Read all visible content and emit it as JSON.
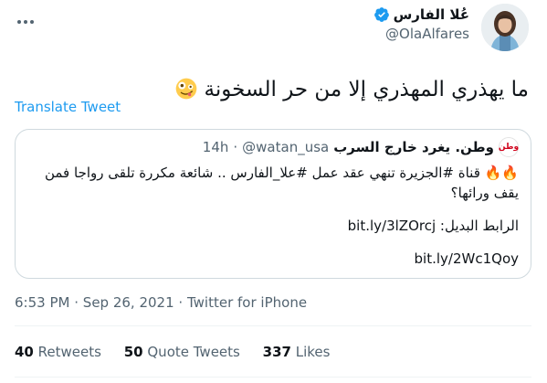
{
  "author": {
    "display_name": "عُلا الفارس",
    "handle": "@OlaAlfares",
    "verified": true,
    "avatar_icon": "woman-avatar-icon"
  },
  "tweet": {
    "text": "ما يهذري المهذري إلا من حر السخونة",
    "emoji": "zany-face-emoji",
    "translate_label": "Translate Tweet"
  },
  "quoted": {
    "name": "وطن. يغرد خارج السرب",
    "handle": "@watan_usa",
    "separator": "·",
    "time": "14h",
    "logo_text": "وطن",
    "line1": "🔥🔥 قناة #الجزيرة تنهي عقد عمل #علا_الفارس .. شائعة مكررة تلقى رواجا فمن يقف ورائها؟",
    "line2_label": "الرابط البديل:",
    "line2_link": "bit.ly/3lZOrcj",
    "line3_link": "bit.ly/2Wc1Qoy"
  },
  "meta": {
    "time": "6:53 PM",
    "separator1": "·",
    "date": "Sep 26, 2021",
    "separator2": "·",
    "source": "Twitter for iPhone"
  },
  "stats": {
    "retweets_count": "40",
    "retweets_label": "Retweets",
    "quotes_count": "50",
    "quotes_label": "Quote Tweets",
    "likes_count": "337",
    "likes_label": "Likes"
  },
  "colors": {
    "accent": "#1d9bf0",
    "secondary_text": "#536471",
    "border": "#cfd9de"
  }
}
